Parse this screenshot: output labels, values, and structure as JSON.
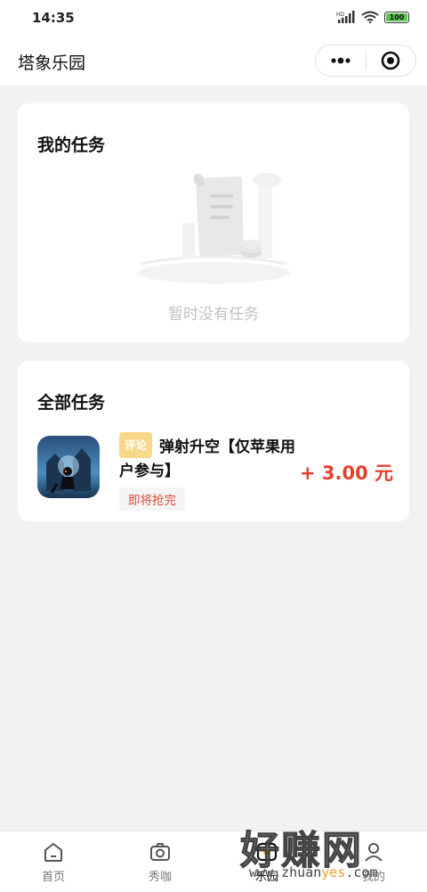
{
  "status_bar": {
    "time": "14:35",
    "battery": "100"
  },
  "nav": {
    "title": "塔象乐园"
  },
  "my_tasks": {
    "title": "我的任务",
    "empty_text": "暂时没有任务"
  },
  "all_tasks": {
    "title": "全部任务",
    "items": [
      {
        "tag": "评论",
        "title": "弹射升空【仅苹果用户参与】",
        "status": "即将抢完",
        "reward": "+ 3.00 元"
      }
    ]
  },
  "tab_bar": {
    "items": [
      {
        "label": "首页",
        "icon": "home-icon"
      },
      {
        "label": "秀咖",
        "icon": "camera-icon"
      },
      {
        "label": "乐园",
        "icon": "playground-icon"
      },
      {
        "label": "我的",
        "icon": "profile-icon"
      }
    ]
  },
  "watermark": {
    "big": "好赚网",
    "small_a": "www.zhuan",
    "small_b": "yes",
    "small_c": ".com"
  }
}
